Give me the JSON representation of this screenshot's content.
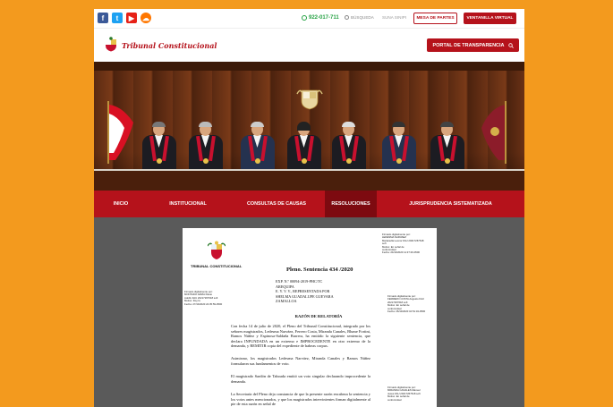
{
  "topbar": {
    "social": [
      "facebook-icon",
      "twitter-icon",
      "youtube-icon",
      "soundcloud-icon"
    ],
    "phone": "922-017-711",
    "search_label": "BÚSQUEDA",
    "sinoe_label": "SUNA SINIPI",
    "mesa_label": "MESA DE PARTES",
    "ventanilla_label": "VENTANILLA VIRTUAL"
  },
  "header": {
    "logo_text": "Tribunal Constitucional",
    "portal_label": "PORTAL DE TRANSPARENCIA"
  },
  "nav": {
    "items": [
      "INICIO",
      "INSTITUCIONAL",
      "CONSULTAS DE CAUSAS",
      "RESOLUCIONES",
      "JURISPRUDENCIA SISTEMATIZADA"
    ],
    "active": "RESOLUCIONES"
  },
  "doc": {
    "org": "TRIBUNAL CONSTITUCIONAL",
    "title": "Pleno. Sentencia 434 /2020",
    "exp_lines": [
      "EXP. N.º 00094-2019-PHC/TC",
      "AREQUIPA",
      "E. Y. V. V., REPRESENTADA POR",
      "SHELMA GUADALUPE GUEVARA",
      "ZAMALLOA"
    ],
    "razon_title": "RAZÓN DE RELATORÍA",
    "para1": "Con fecha 14 de julio de 2020, el Pleno del Tribunal Constitucional, integrado por los señores magistrados, Ledesma Narváez, Ferrero Costa, Miranda Canales, Blume Fortini, Ramos Núñez y Espinosa-Saldaña Barrera, ha emitido la siguiente sentencia, que declara INFUNDADA en un extremo e IMPROCEDENTE en otro extremo de la demanda, y REMITIR copia del expediente de habeas corpus.",
    "para2": "Asimismo, los magistrados Ledesma Narváez, Miranda Canales y Ramos Núñez formularon sus fundamentos de voto.",
    "para3": "El magistrado Sardón de Taboada emitió un voto singular declarando improcedente la demanda.",
    "para4": "La Secretaría del Pleno deja constancia de que la presente razón encabeza la sentencia y los votos antes mencionados, y que los magistrados intervinientes firman digitalmente al pie de esta razón en señal de",
    "sig_top_right": [
      "Firmado digitalmente por:",
      "LEDESMA NARVAEZ",
      "Marianella Leonor FAU 20217267618",
      "soft",
      "Motivo: En señal de",
      "conformidad",
      "Fecha: 24/10/2020 11:37:29-0500"
    ],
    "sig_left": [
      "Firmado digitalmente por:",
      "MONTADO ARIZA Flavio",
      "Adolfo FAU 20217267618 soft",
      "Motivo: Doy fe",
      "Fecha: 27/10/2020 22:35:59-0500"
    ],
    "sig_right_mid": [
      "Firmado digitalmente por:",
      "FERRERO COSTA Augusto FAU",
      "20217267618 soft",
      "Motivo: En señal de",
      "conformidad",
      "Fecha: 26/10/2020 10:51:34-0500"
    ],
    "sig_right_bottom": [
      "Firmado digitalmente por:",
      "MIRANDA CANALES Manuel",
      "Jesus FAU 20217267618 soft",
      "Motivo: En señal de",
      "conformidad"
    ]
  },
  "colors": {
    "brand_red": "#b5121b",
    "nav_active": "#7d0a10",
    "background": "#f39a1e",
    "viewer_bg": "#5a5a5a",
    "phone_green": "#26a244"
  }
}
